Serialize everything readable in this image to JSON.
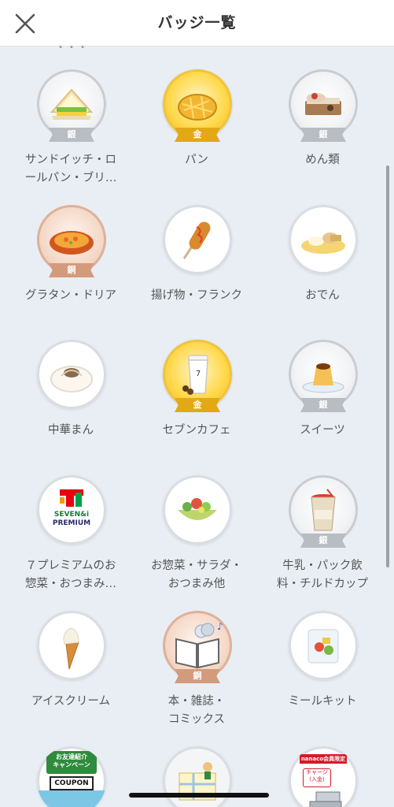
{
  "header": {
    "title": "バッジ一覧",
    "close_icon": "close-icon"
  },
  "top_partial_text": "・・・",
  "badges": [
    {
      "label": "サンドイッチ・ロ\nールパン・ブリ…",
      "rank": "銀",
      "icon": "sandwich-icon"
    },
    {
      "label": "パン",
      "rank": "金",
      "icon": "melon-pan-icon"
    },
    {
      "label": "めん類",
      "rank": "銀",
      "icon": "noodles-icon"
    },
    {
      "label": "グラタン・ドリア",
      "rank": "銅",
      "icon": "gratin-icon"
    },
    {
      "label": "揚げ物・フランク",
      "rank": "",
      "icon": "corn-dog-icon"
    },
    {
      "label": "おでん",
      "rank": "",
      "icon": "oden-icon"
    },
    {
      "label": "中華まん",
      "rank": "",
      "icon": "steamed-bun-icon"
    },
    {
      "label": "セブンカフェ",
      "rank": "金",
      "icon": "coffee-cup-icon"
    },
    {
      "label": "スイーツ",
      "rank": "銀",
      "icon": "pudding-icon"
    },
    {
      "label": "７プレミアムのお\n惣菜・おつまみ…",
      "rank": "",
      "icon": "seven-premium-logo-icon"
    },
    {
      "label": "お惣菜・サラダ・\nおつまみ他",
      "rank": "",
      "icon": "salad-icon"
    },
    {
      "label": "牛乳・パック飲\n料・チルドカップ",
      "rank": "銀",
      "icon": "chilled-cup-icon"
    },
    {
      "label": "アイスクリーム",
      "rank": "",
      "icon": "ice-cream-icon"
    },
    {
      "label": "本・雑誌・\nコミックス",
      "rank": "銅",
      "icon": "book-icon"
    },
    {
      "label": "ミールキット",
      "rank": "",
      "icon": "meal-kit-icon"
    },
    {
      "label": "",
      "rank": "",
      "icon": "coupon-campaign-icon"
    },
    {
      "label": "",
      "rank": "",
      "icon": "map-icon"
    },
    {
      "label": "",
      "rank": "",
      "icon": "nanaco-register-icon"
    }
  ],
  "seven_premium": {
    "line1": "SEVEN&i",
    "line2": "PREMIUM"
  },
  "coupon": {
    "title": "お友達紹介\nキャンペーン",
    "coupon": "COUPON"
  },
  "nanaco": {
    "brand": "nanaco会員限定",
    "bubble": "チャージ\n(入金)"
  },
  "colors": {
    "gold": "#e2a915",
    "silver": "#b8bcc3",
    "bronze": "#d39b7c",
    "background": "#e9eef4"
  }
}
